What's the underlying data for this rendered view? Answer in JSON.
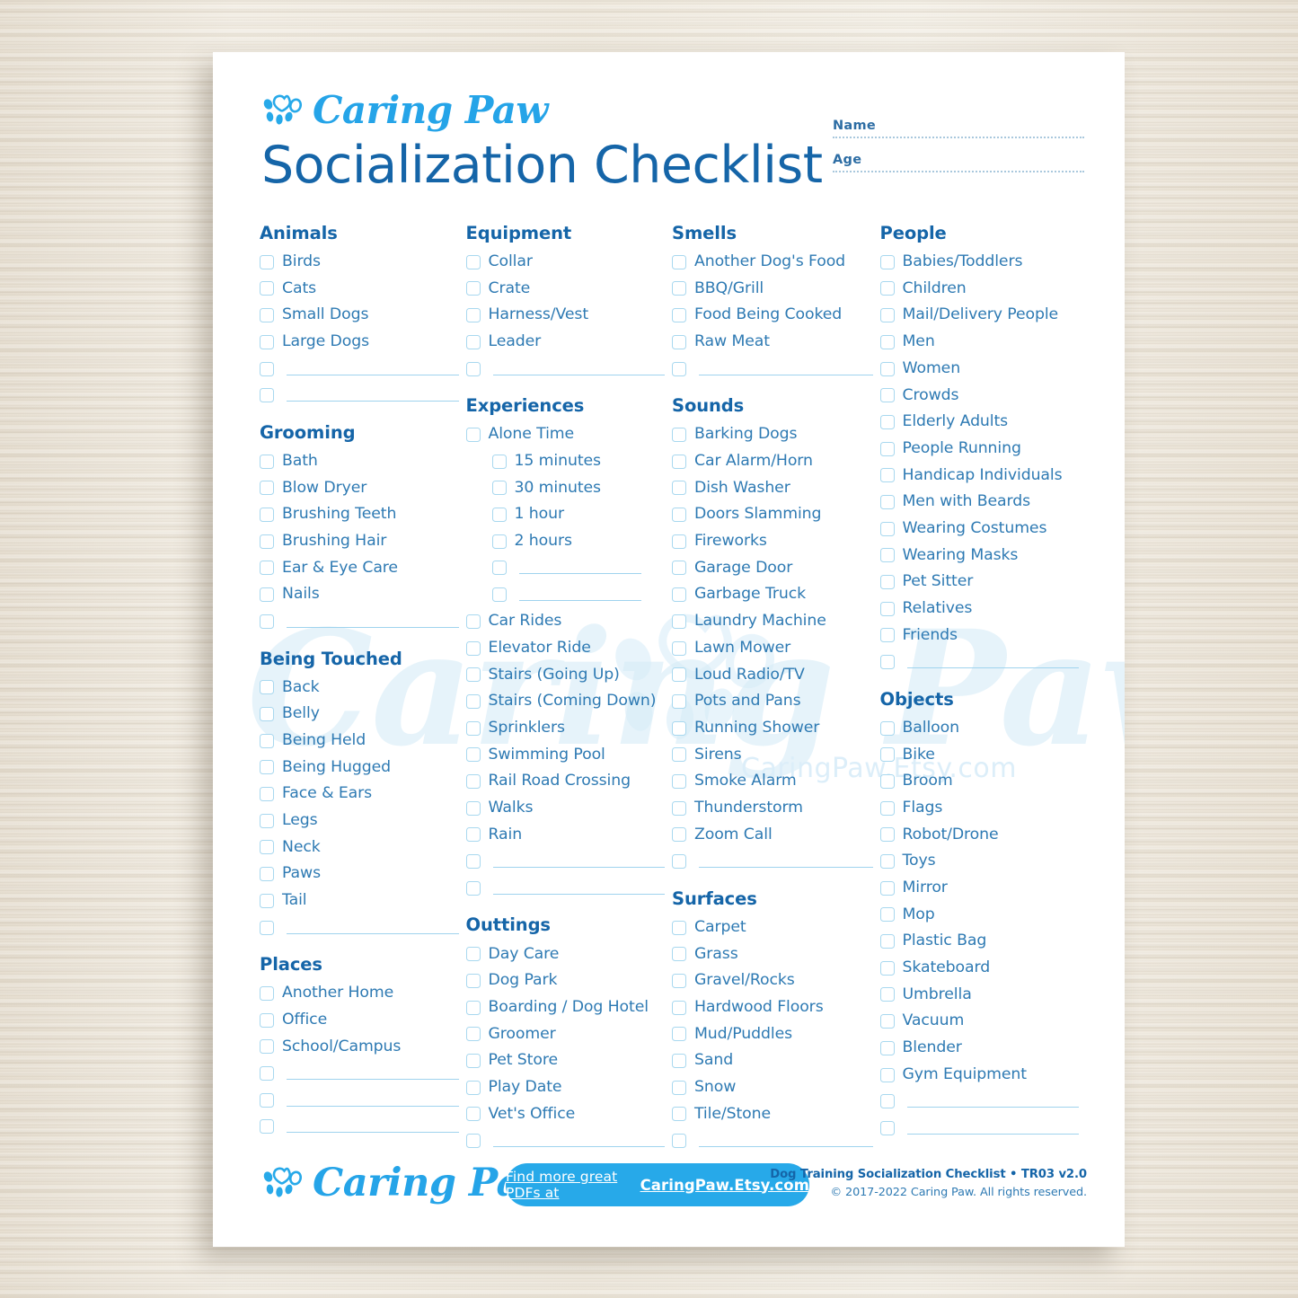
{
  "brand": {
    "name": "Caring Paw",
    "logo_icon": "paw-heart-icon"
  },
  "header": {
    "title": "Socialization Checklist",
    "fields": [
      {
        "label": "Name",
        "value": ""
      },
      {
        "label": "Age",
        "value": ""
      }
    ]
  },
  "watermark": {
    "script": "Caring Paw",
    "url": "CaringPaw.Etsy.com"
  },
  "colors": {
    "brand_cyan": "#27a9e9",
    "heading_blue": "#1565a8",
    "item_blue": "#2e7ab3",
    "checkbox_border": "#a8d8ef",
    "paper": "#ffffff",
    "background": "#eee8dd"
  },
  "columns": [
    {
      "sections": [
        {
          "title": "Animals",
          "items": [
            {
              "label": "Birds"
            },
            {
              "label": "Cats"
            },
            {
              "label": "Small Dogs"
            },
            {
              "label": "Large Dogs"
            },
            {
              "label": "",
              "blank": true
            },
            {
              "label": "",
              "blank": true
            }
          ]
        },
        {
          "title": "Grooming",
          "items": [
            {
              "label": "Bath"
            },
            {
              "label": "Blow Dryer"
            },
            {
              "label": "Brushing Teeth"
            },
            {
              "label": "Brushing Hair"
            },
            {
              "label": "Ear & Eye Care"
            },
            {
              "label": "Nails"
            },
            {
              "label": "",
              "blank": true
            }
          ]
        },
        {
          "title": "Being Touched",
          "items": [
            {
              "label": "Back"
            },
            {
              "label": "Belly"
            },
            {
              "label": "Being Held"
            },
            {
              "label": "Being Hugged"
            },
            {
              "label": "Face & Ears"
            },
            {
              "label": "Legs"
            },
            {
              "label": "Neck"
            },
            {
              "label": "Paws"
            },
            {
              "label": "Tail"
            },
            {
              "label": "",
              "blank": true
            }
          ]
        },
        {
          "title": "Places",
          "items": [
            {
              "label": "Another Home"
            },
            {
              "label": "Office"
            },
            {
              "label": "School/Campus"
            },
            {
              "label": "",
              "blank": true
            },
            {
              "label": "",
              "blank": true
            },
            {
              "label": "",
              "blank": true
            }
          ]
        }
      ]
    },
    {
      "sections": [
        {
          "title": "Equipment",
          "items": [
            {
              "label": "Collar"
            },
            {
              "label": "Crate"
            },
            {
              "label": "Harness/Vest"
            },
            {
              "label": "Leader"
            },
            {
              "label": "",
              "blank": true
            }
          ]
        },
        {
          "title": "Experiences",
          "items": [
            {
              "label": "Alone Time"
            },
            {
              "label": "15 minutes",
              "sub": true
            },
            {
              "label": "30 minutes",
              "sub": true
            },
            {
              "label": "1 hour",
              "sub": true
            },
            {
              "label": "2 hours",
              "sub": true
            },
            {
              "label": "",
              "blank": true,
              "sub": true
            },
            {
              "label": "",
              "blank": true,
              "sub": true
            },
            {
              "label": "Car Rides"
            },
            {
              "label": "Elevator Ride"
            },
            {
              "label": "Stairs (Going Up)"
            },
            {
              "label": "Stairs (Coming Down)"
            },
            {
              "label": "Sprinklers"
            },
            {
              "label": "Swimming Pool"
            },
            {
              "label": "Rail Road Crossing"
            },
            {
              "label": "Walks"
            },
            {
              "label": "Rain"
            },
            {
              "label": "",
              "blank": true
            },
            {
              "label": "",
              "blank": true
            }
          ]
        },
        {
          "title": "Outtings",
          "items": [
            {
              "label": "Day Care"
            },
            {
              "label": "Dog Park"
            },
            {
              "label": "Boarding / Dog Hotel"
            },
            {
              "label": "Groomer"
            },
            {
              "label": "Pet Store"
            },
            {
              "label": "Play Date"
            },
            {
              "label": "Vet's Office"
            },
            {
              "label": "",
              "blank": true
            }
          ]
        }
      ]
    },
    {
      "sections": [
        {
          "title": "Smells",
          "items": [
            {
              "label": "Another Dog's Food"
            },
            {
              "label": "BBQ/Grill"
            },
            {
              "label": "Food Being Cooked"
            },
            {
              "label": "Raw Meat"
            },
            {
              "label": "",
              "blank": true
            }
          ]
        },
        {
          "title": "Sounds",
          "items": [
            {
              "label": "Barking Dogs"
            },
            {
              "label": "Car Alarm/Horn"
            },
            {
              "label": "Dish Washer"
            },
            {
              "label": "Doors Slamming"
            },
            {
              "label": "Fireworks"
            },
            {
              "label": "Garage Door"
            },
            {
              "label": "Garbage Truck"
            },
            {
              "label": "Laundry Machine"
            },
            {
              "label": "Lawn Mower"
            },
            {
              "label": "Loud Radio/TV"
            },
            {
              "label": "Pots and Pans"
            },
            {
              "label": "Running Shower"
            },
            {
              "label": "Sirens"
            },
            {
              "label": "Smoke Alarm"
            },
            {
              "label": "Thunderstorm"
            },
            {
              "label": "Zoom Call"
            },
            {
              "label": "",
              "blank": true
            }
          ]
        },
        {
          "title": "Surfaces",
          "items": [
            {
              "label": "Carpet"
            },
            {
              "label": "Grass"
            },
            {
              "label": "Gravel/Rocks"
            },
            {
              "label": "Hardwood Floors"
            },
            {
              "label": "Mud/Puddles"
            },
            {
              "label": "Sand"
            },
            {
              "label": "Snow"
            },
            {
              "label": "Tile/Stone"
            },
            {
              "label": "",
              "blank": true
            }
          ]
        }
      ]
    },
    {
      "sections": [
        {
          "title": "People",
          "items": [
            {
              "label": "Babies/Toddlers"
            },
            {
              "label": "Children"
            },
            {
              "label": "Mail/Delivery People"
            },
            {
              "label": "Men"
            },
            {
              "label": "Women"
            },
            {
              "label": "Crowds"
            },
            {
              "label": "Elderly Adults"
            },
            {
              "label": "People Running"
            },
            {
              "label": "Handicap Individuals"
            },
            {
              "label": "Men with Beards"
            },
            {
              "label": "Wearing Costumes"
            },
            {
              "label": "Wearing Masks"
            },
            {
              "label": "Pet Sitter"
            },
            {
              "label": "Relatives"
            },
            {
              "label": "Friends"
            },
            {
              "label": "",
              "blank": true
            }
          ]
        },
        {
          "title": "Objects",
          "items": [
            {
              "label": "Balloon"
            },
            {
              "label": "Bike"
            },
            {
              "label": "Broom"
            },
            {
              "label": "Flags"
            },
            {
              "label": "Robot/Drone"
            },
            {
              "label": "Toys"
            },
            {
              "label": "Mirror"
            },
            {
              "label": "Mop"
            },
            {
              "label": "Plastic Bag"
            },
            {
              "label": "Skateboard"
            },
            {
              "label": "Umbrella"
            },
            {
              "label": "Vacuum"
            },
            {
              "label": "Blender"
            },
            {
              "label": "Gym Equipment"
            },
            {
              "label": "",
              "blank": true
            },
            {
              "label": "",
              "blank": true
            }
          ]
        }
      ]
    }
  ],
  "footer": {
    "cta_prefix": "Find more great PDFs at",
    "cta_url": "CaringPaw.Etsy.com",
    "legal_line1": "Dog Training Socialization Checklist • TR03 v2.0",
    "legal_line2": "© 2017-2022 Caring Paw. All rights reserved."
  }
}
